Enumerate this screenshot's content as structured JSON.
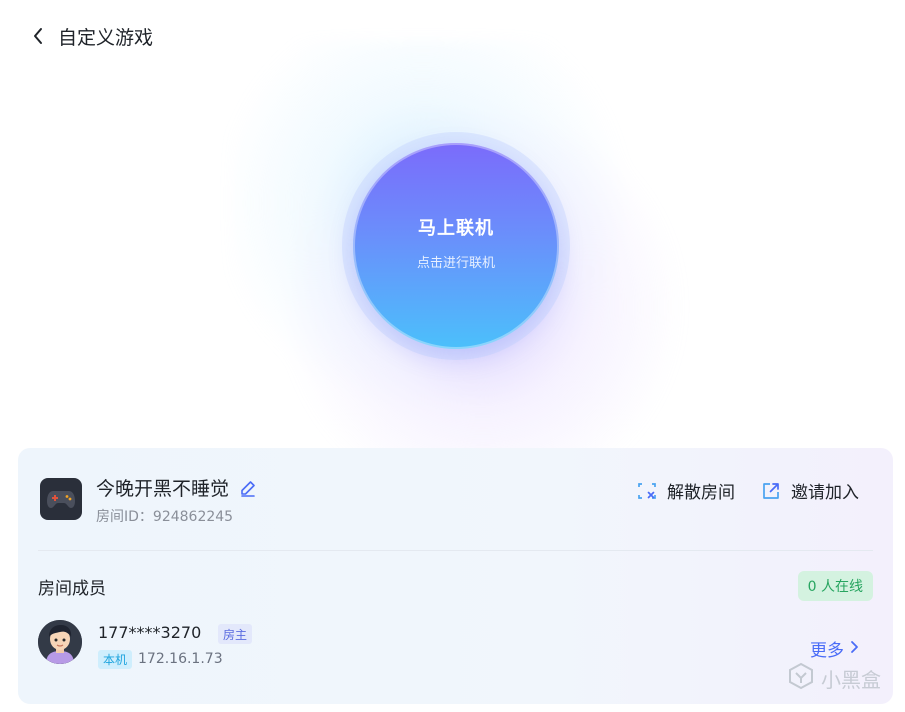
{
  "header": {
    "title": "自定义游戏"
  },
  "connect": {
    "title": "马上联机",
    "subtitle": "点击进行联机"
  },
  "room": {
    "name": "今晚开黑不睡觉",
    "id_label": "房间ID：",
    "id_value": "924862245",
    "actions": {
      "dissolve": "解散房间",
      "invite": "邀请加入"
    }
  },
  "members": {
    "label": "房间成员",
    "online_badge": "0 人在线",
    "list": [
      {
        "phone": "177****3270",
        "role_tag": "房主",
        "local_tag": "本机",
        "ip": "172.16.1.73"
      }
    ],
    "more_label": "更多"
  },
  "watermark": {
    "text": "小黑盒"
  },
  "colors": {
    "accent": "#4a6cf7",
    "online": "#27a560",
    "circle_top": "#7b6bfb",
    "circle_bottom": "#4bc0fb"
  }
}
